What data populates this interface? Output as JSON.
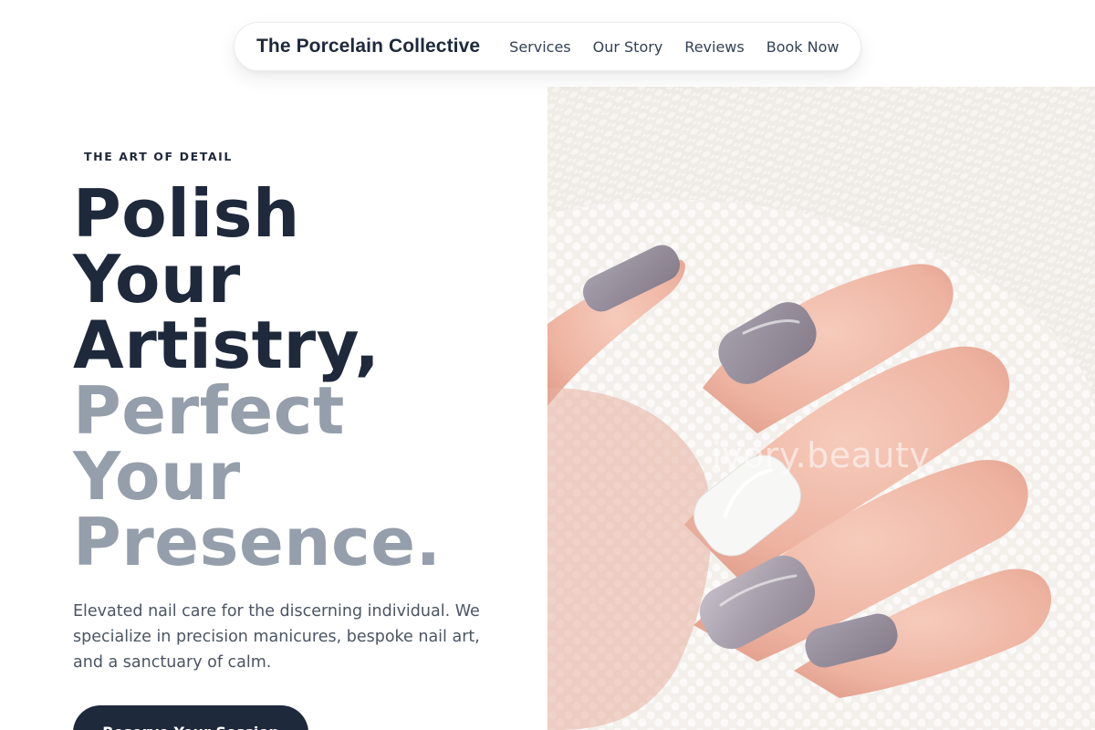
{
  "nav": {
    "brand": "The Porcelain Collective",
    "links": [
      "Services",
      "Our Story",
      "Reviews",
      "Book Now"
    ]
  },
  "hero": {
    "eyebrow": "THE ART OF DETAIL",
    "headline_dark": [
      "Polish",
      "Your",
      "Artistry,"
    ],
    "headline_muted": [
      "Perfect",
      "Your",
      "Presence."
    ],
    "description": "Elevated nail care for the discerning individual. We specialize in precision manicures, bespoke nail art, and a sanctuary of calm.",
    "cta_label": "Reserve Your Session"
  },
  "image": {
    "watermark": "ivory.beauty",
    "subject": "hand with lavender-grey, white and silver glitter manicure resting on a cream knit sweater"
  },
  "colors": {
    "primary": "#1e293b",
    "muted_heading": "#959eab",
    "body_text": "#4b5563",
    "nail_lavender": "#948c98",
    "nail_white": "#f8f8f8",
    "nail_glitter": "#a9a0aa"
  }
}
